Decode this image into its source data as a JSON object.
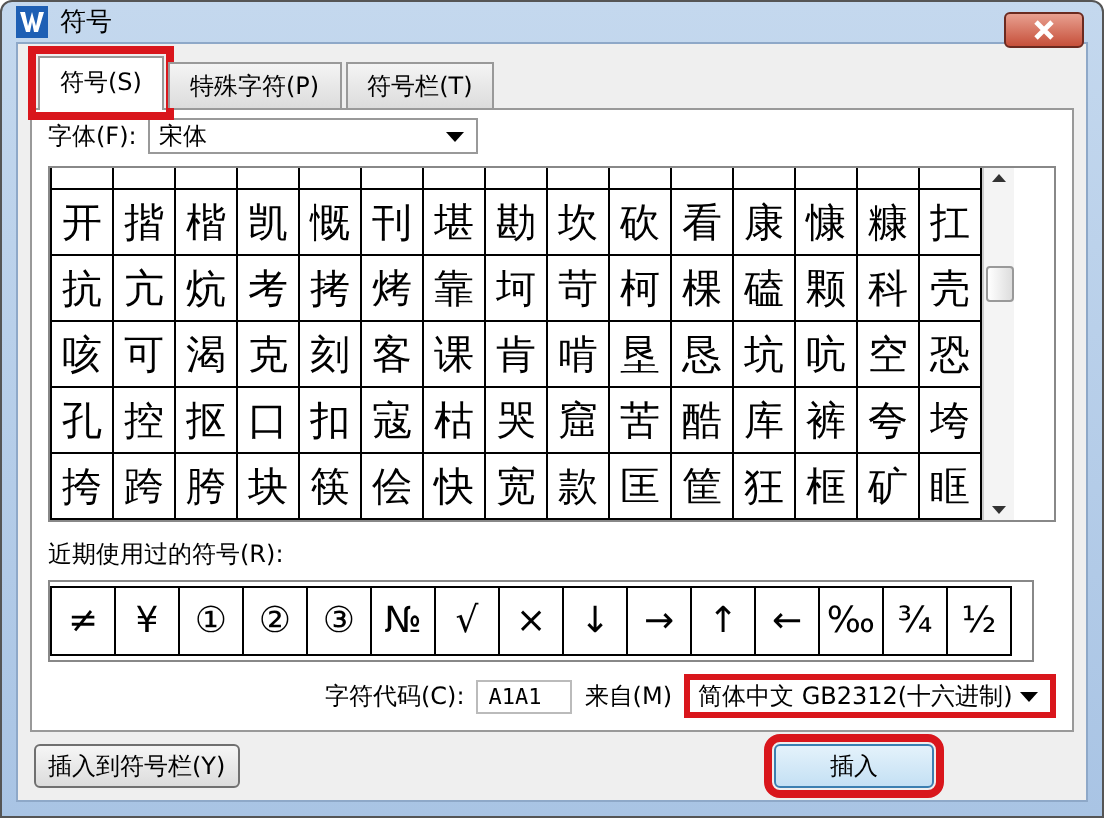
{
  "window": {
    "title": "符号"
  },
  "tabs": [
    {
      "label": "符号(S)",
      "selected": true,
      "highlighted": true
    },
    {
      "label": "特殊字符(P)",
      "selected": false,
      "highlighted": false
    },
    {
      "label": "符号栏(T)",
      "selected": false,
      "highlighted": false
    }
  ],
  "font": {
    "label": "字体(F):",
    "value": "宋体"
  },
  "symbol_grid": {
    "rows": [
      [
        "开",
        "揩",
        "楷",
        "凯",
        "慨",
        "刊",
        "堪",
        "勘",
        "坎",
        "砍",
        "看",
        "康",
        "慷",
        "糠",
        "扛"
      ],
      [
        "抗",
        "亢",
        "炕",
        "考",
        "拷",
        "烤",
        "靠",
        "坷",
        "苛",
        "柯",
        "棵",
        "磕",
        "颗",
        "科",
        "壳"
      ],
      [
        "咳",
        "可",
        "渴",
        "克",
        "刻",
        "客",
        "课",
        "肯",
        "啃",
        "垦",
        "恳",
        "坑",
        "吭",
        "空",
        "恐"
      ],
      [
        "孔",
        "控",
        "抠",
        "口",
        "扣",
        "寇",
        "枯",
        "哭",
        "窟",
        "苦",
        "酷",
        "库",
        "裤",
        "夸",
        "垮"
      ],
      [
        "挎",
        "跨",
        "胯",
        "块",
        "筷",
        "侩",
        "快",
        "宽",
        "款",
        "匡",
        "筐",
        "狂",
        "框",
        "矿",
        "眶"
      ]
    ]
  },
  "recent": {
    "label": "近期使用过的符号(R):",
    "symbols": [
      "≠",
      "¥",
      "①",
      "②",
      "③",
      "№",
      "√",
      "×",
      "↓",
      "→",
      "↑",
      "←",
      "‰",
      "¾",
      "½"
    ]
  },
  "char_code": {
    "label": "字符代码(C):",
    "value": "A1A1"
  },
  "from": {
    "label": "来自(M)",
    "value": "简体中文 GB2312(十六进制)",
    "highlighted": true
  },
  "buttons": [
    {
      "label": "插入到符号栏(Y)",
      "highlighted": false
    },
    {
      "label": "插入",
      "highlighted": true
    }
  ]
}
